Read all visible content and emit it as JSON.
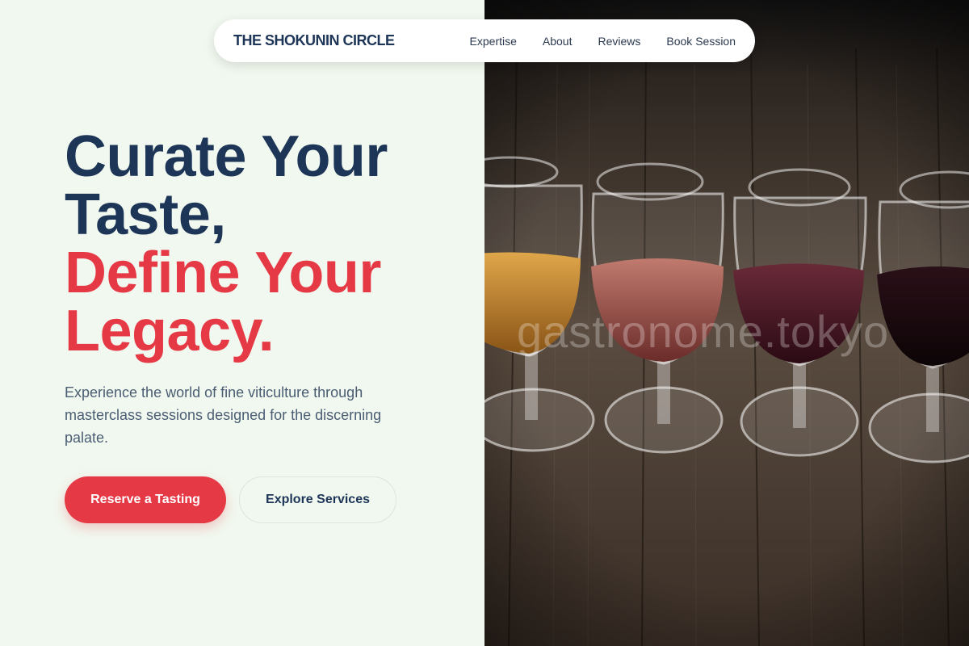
{
  "nav": {
    "brand": "THE SHOKUNIN CIRCLE",
    "links": [
      "Expertise",
      "About",
      "Reviews",
      "Book Session"
    ]
  },
  "hero": {
    "headline_line1": "Curate Your",
    "headline_line2": "Taste,",
    "headline_line3": "Define Your",
    "headline_line4": "Legacy.",
    "subtext": "Experience the world of fine viticulture through masterclass sessions designed for the discerning palate.",
    "primary_button": "Reserve a Tasting",
    "secondary_button": "Explore Services"
  },
  "image": {
    "description_icon": "wine-glasses-photo",
    "watermark": "gastronome.tokyo"
  },
  "colors": {
    "background": "#f1f8ef",
    "navy": "#1d3557",
    "accent_red": "#e63946",
    "body_text": "#4a5d73"
  }
}
